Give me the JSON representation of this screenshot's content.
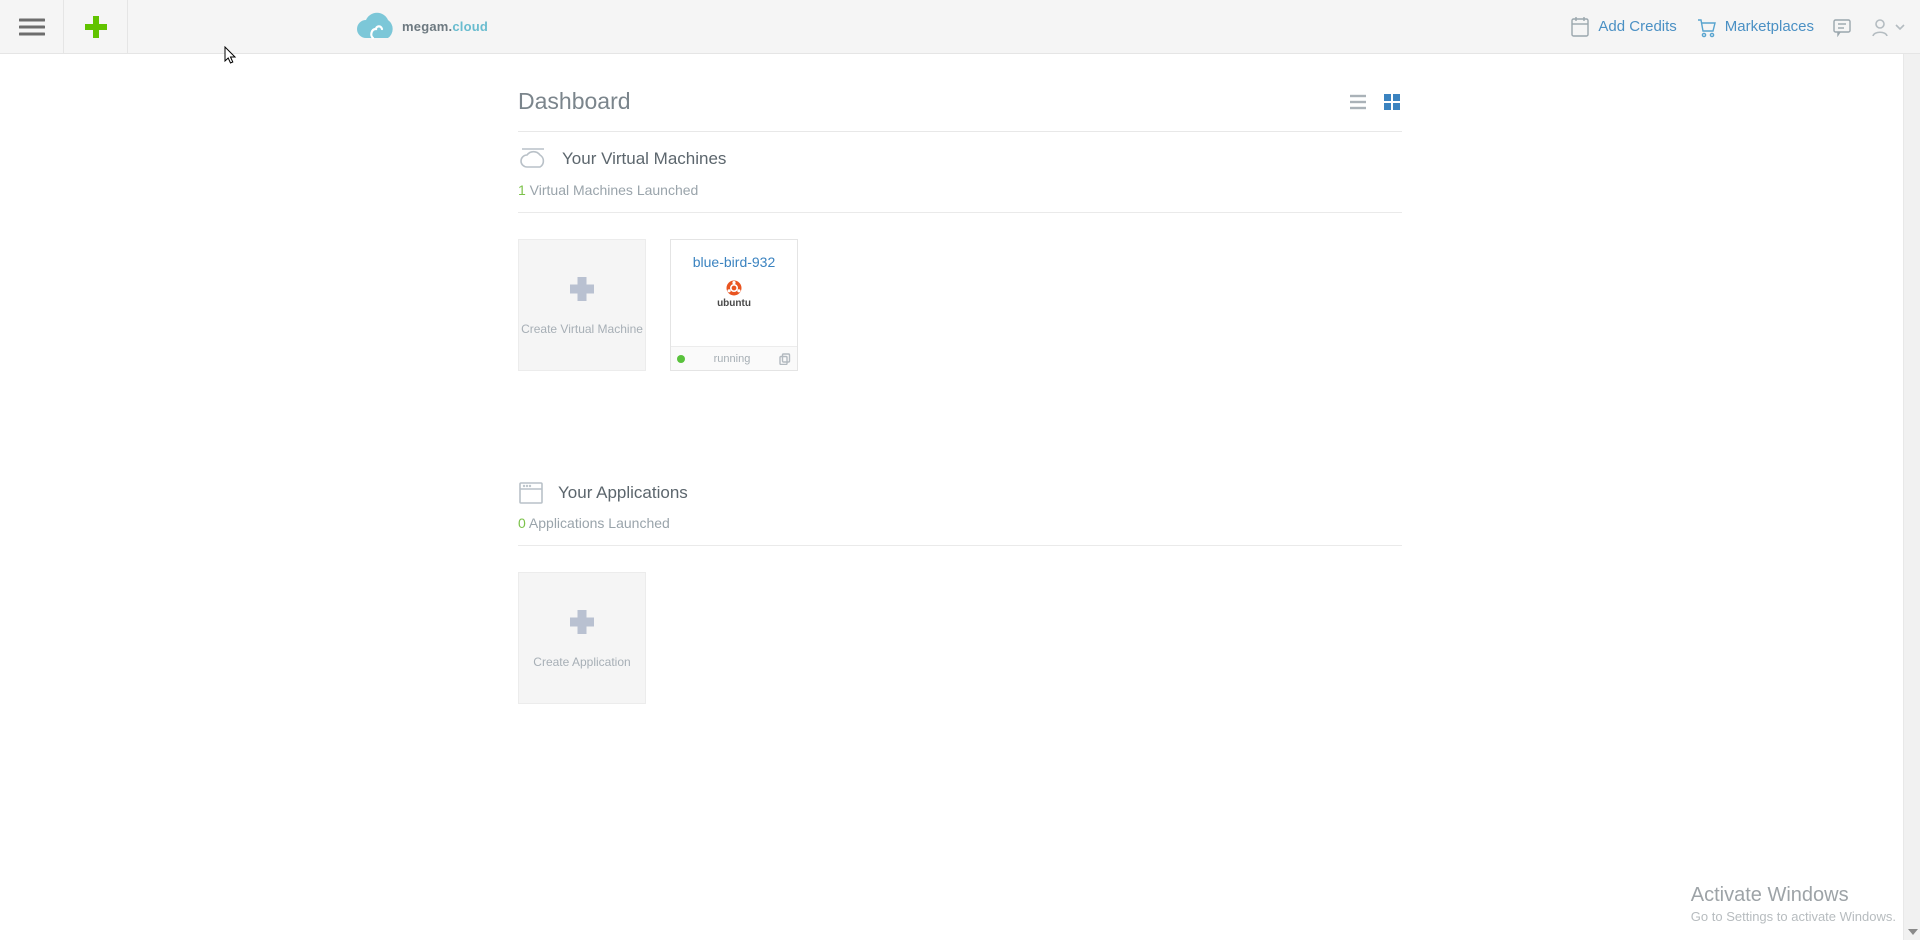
{
  "brand": {
    "name_a": "megam.",
    "name_b": "cloud"
  },
  "nav": {
    "add_credits": "Add Credits",
    "marketplaces": "Marketplaces"
  },
  "page": {
    "title": "Dashboard"
  },
  "vms": {
    "section_title": "Your Virtual Machines",
    "count": "1",
    "count_suffix": " Virtual Machines Launched",
    "create_label": "Create Virtual Machine",
    "cards": [
      {
        "name": "blue-bird-932",
        "distro": "ubuntu",
        "status": "running"
      }
    ]
  },
  "apps": {
    "section_title": "Your Applications",
    "count": "0",
    "count_suffix": " Applications Launched",
    "create_label": "Create Application"
  },
  "watermark": {
    "line1": "Activate Windows",
    "line2": "Go to Settings to activate Windows."
  }
}
